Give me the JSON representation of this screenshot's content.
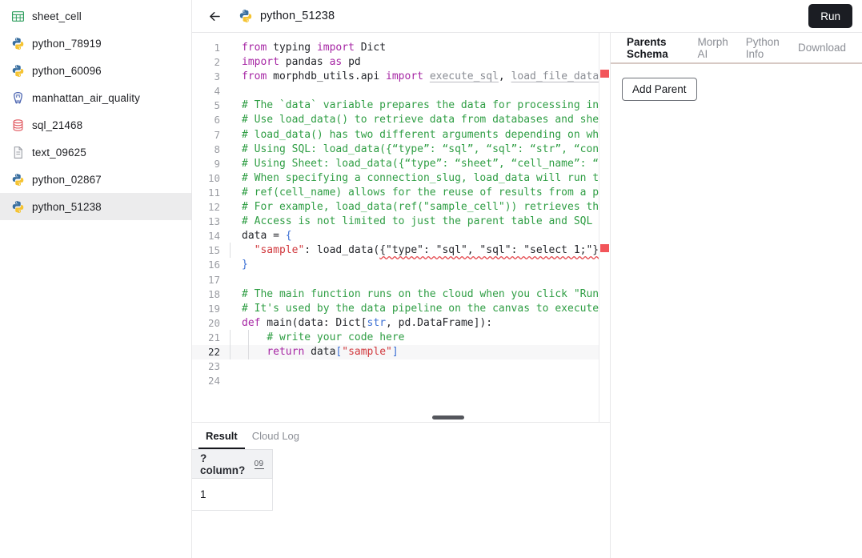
{
  "sidebar": {
    "items": [
      {
        "label": "sheet_cell",
        "icon": "spreadsheet-icon",
        "selected": false
      },
      {
        "label": "python_78919",
        "icon": "python-icon",
        "selected": false
      },
      {
        "label": "python_60096",
        "icon": "python-icon",
        "selected": false
      },
      {
        "label": "manhattan_air_quality",
        "icon": "postgres-icon",
        "selected": false
      },
      {
        "label": "sql_21468",
        "icon": "database-icon",
        "selected": false
      },
      {
        "label": "text_09625",
        "icon": "document-icon",
        "selected": false
      },
      {
        "label": "python_02867",
        "icon": "python-icon",
        "selected": false
      },
      {
        "label": "python_51238",
        "icon": "python-icon",
        "selected": true
      }
    ]
  },
  "topbar": {
    "back_icon": "arrow-left-icon",
    "file_icon": "python-icon",
    "title": "python_51238",
    "run_label": "Run"
  },
  "editor": {
    "active_line": 22,
    "total_lines": 24,
    "lines": [
      {
        "n": 1,
        "tokens": [
          {
            "t": "from",
            "c": "k"
          },
          {
            "t": " typing ",
            "c": ""
          },
          {
            "t": "import",
            "c": "k"
          },
          {
            "t": " Dict",
            "c": ""
          }
        ]
      },
      {
        "n": 2,
        "tokens": [
          {
            "t": "import",
            "c": "k"
          },
          {
            "t": " pandas ",
            "c": ""
          },
          {
            "t": "as",
            "c": "k"
          },
          {
            "t": " pd",
            "c": ""
          }
        ]
      },
      {
        "n": 3,
        "tokens": [
          {
            "t": "from",
            "c": "k"
          },
          {
            "t": " morphdb_utils.api ",
            "c": ""
          },
          {
            "t": "import",
            "c": "k"
          },
          {
            "t": " ",
            "c": ""
          },
          {
            "t": "execute_sql",
            "c": "grey err"
          },
          {
            "t": ", ",
            "c": ""
          },
          {
            "t": "load_file_data",
            "c": "grey err"
          },
          {
            "t": ", load",
            "c": ""
          }
        ]
      },
      {
        "n": 4,
        "tokens": []
      },
      {
        "n": 5,
        "tokens": [
          {
            "t": "# The `data` variable prepares the data for processing in both t",
            "c": "cm"
          }
        ]
      },
      {
        "n": 6,
        "tokens": [
          {
            "t": "# Use load_data() to retrieve data from databases and sheets.",
            "c": "cm"
          }
        ]
      },
      {
        "n": 7,
        "tokens": [
          {
            "t": "# load_data() has two different arguments depending on whether i",
            "c": "cm"
          }
        ]
      },
      {
        "n": 8,
        "tokens": [
          {
            "t": "# Using SQL: load_data({“type”: “sql”, “sql”: “str”, “connection",
            "c": "cm"
          }
        ]
      },
      {
        "n": 9,
        "tokens": [
          {
            "t": "# Using Sheet: load_data({“type”: “sheet”, “cell_name”: “str”, “",
            "c": "cm"
          }
        ]
      },
      {
        "n": 10,
        "tokens": [
          {
            "t": "# When specifying a connection_slug, load_data will run the SQL",
            "c": "cm"
          }
        ]
      },
      {
        "n": 11,
        "tokens": [
          {
            "t": "# ref(cell_name) allows for the reuse of results from a previous",
            "c": "cm"
          }
        ]
      },
      {
        "n": 12,
        "tokens": [
          {
            "t": "# For example, load_data(ref(\"sample_cell\")) retrieves the resul",
            "c": "cm"
          }
        ]
      },
      {
        "n": 13,
        "tokens": [
          {
            "t": "# Access is not limited to just the parent table and SQL cells c",
            "c": "cm"
          }
        ]
      },
      {
        "n": 14,
        "tokens": [
          {
            "t": "data = ",
            "c": ""
          },
          {
            "t": "{",
            "c": "bl"
          }
        ]
      },
      {
        "n": 15,
        "indent": 1,
        "tokens": [
          {
            "t": "  ",
            "c": ""
          },
          {
            "t": "\"sample\"",
            "c": "st"
          },
          {
            "t": ": load_data(",
            "c": ""
          },
          {
            "t": "{\"type\": \"sql\", \"sql\": \"select 1;\"}",
            "c": "err"
          },
          {
            "t": "),",
            "c": ""
          }
        ]
      },
      {
        "n": 16,
        "tokens": [
          {
            "t": "}",
            "c": "bl"
          }
        ]
      },
      {
        "n": 17,
        "tokens": []
      },
      {
        "n": 18,
        "tokens": [
          {
            "t": "# The main function runs on the cloud when you click \"Run on Clo",
            "c": "cm"
          }
        ]
      },
      {
        "n": 19,
        "tokens": [
          {
            "t": "# It's used by the data pipeline on the canvas to execute your D",
            "c": "cm"
          }
        ]
      },
      {
        "n": 20,
        "tokens": [
          {
            "t": "def",
            "c": "k"
          },
          {
            "t": " main(data: Dict[",
            "c": ""
          },
          {
            "t": "str",
            "c": "bl"
          },
          {
            "t": ", pd.DataFrame]):",
            "c": ""
          }
        ]
      },
      {
        "n": 21,
        "indent": 2,
        "tokens": [
          {
            "t": "    ",
            "c": ""
          },
          {
            "t": "# write your code here",
            "c": "cm"
          }
        ]
      },
      {
        "n": 22,
        "indent": 2,
        "tokens": [
          {
            "t": "    ",
            "c": ""
          },
          {
            "t": "return",
            "c": "k"
          },
          {
            "t": " data",
            "c": ""
          },
          {
            "t": "[",
            "c": "bl"
          },
          {
            "t": "\"sample\"",
            "c": "st"
          },
          {
            "t": "]",
            "c": "bl"
          }
        ]
      },
      {
        "n": 23,
        "tokens": []
      },
      {
        "n": 24,
        "tokens": []
      }
    ],
    "error_marker_color": "#f2555a",
    "keyword_color": "#a626a4",
    "comment_color": "#2f9e44",
    "string_color": "#d1383d"
  },
  "result": {
    "tabs": [
      {
        "label": "Result",
        "active": true
      },
      {
        "label": "Cloud Log",
        "active": false
      }
    ],
    "columns": [
      {
        "name": "?column?",
        "type_badge": "09"
      }
    ],
    "rows": [
      [
        "1"
      ]
    ]
  },
  "right_panel": {
    "tabs": [
      {
        "label": "Parents Schema",
        "active": true
      },
      {
        "label": "Morph AI",
        "active": false
      },
      {
        "label": "Python Info",
        "active": false
      },
      {
        "label": "Download",
        "active": false
      }
    ],
    "add_parent_label": "Add Parent"
  }
}
